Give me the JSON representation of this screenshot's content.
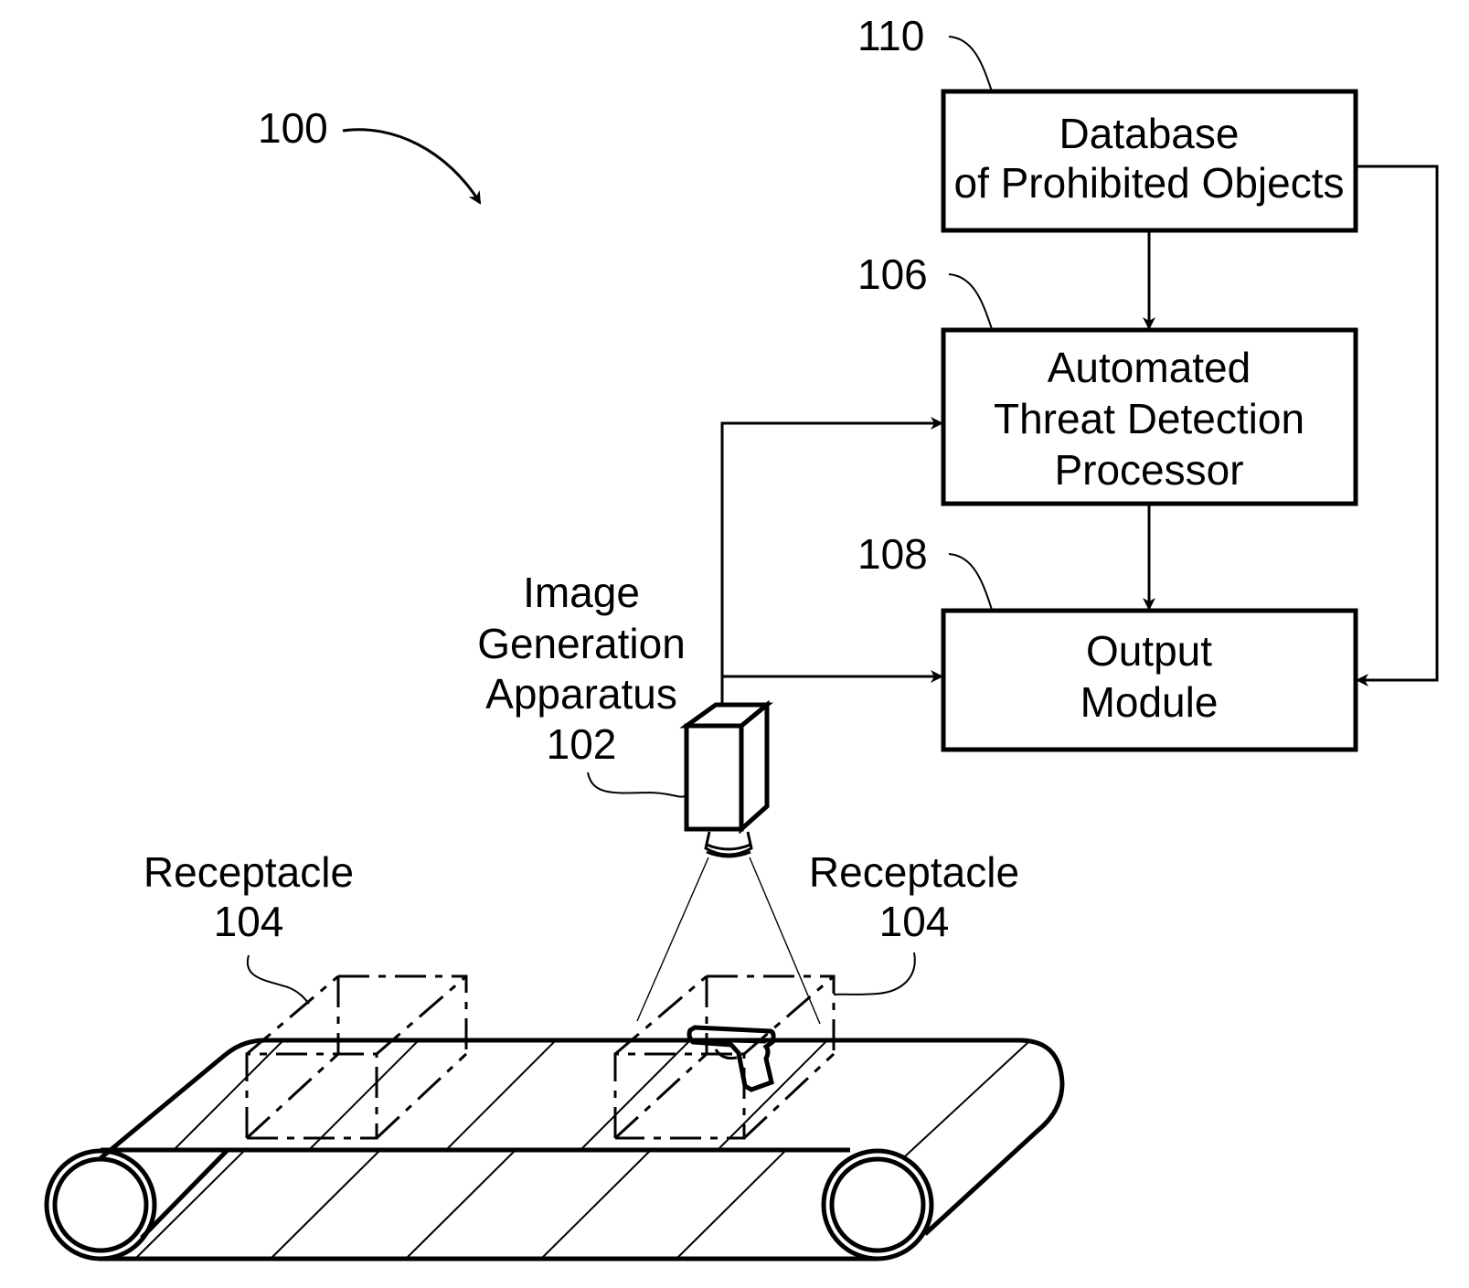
{
  "figure": {
    "system_ref": "100",
    "blocks": [
      {
        "id": "database",
        "ref": "110",
        "lines": [
          "Database",
          "of Prohibited Objects"
        ]
      },
      {
        "id": "processor",
        "ref": "106",
        "lines": [
          "Automated",
          "Threat Detection",
          "Processor"
        ]
      },
      {
        "id": "output",
        "ref": "108",
        "lines": [
          "Output",
          "Module"
        ]
      }
    ],
    "apparatus": {
      "lines": [
        "Image",
        "Generation",
        "Apparatus"
      ],
      "ref": "102"
    },
    "receptacle_left": {
      "label": "Receptacle",
      "ref": "104"
    },
    "receptacle_right": {
      "label": "Receptacle",
      "ref": "104"
    }
  }
}
